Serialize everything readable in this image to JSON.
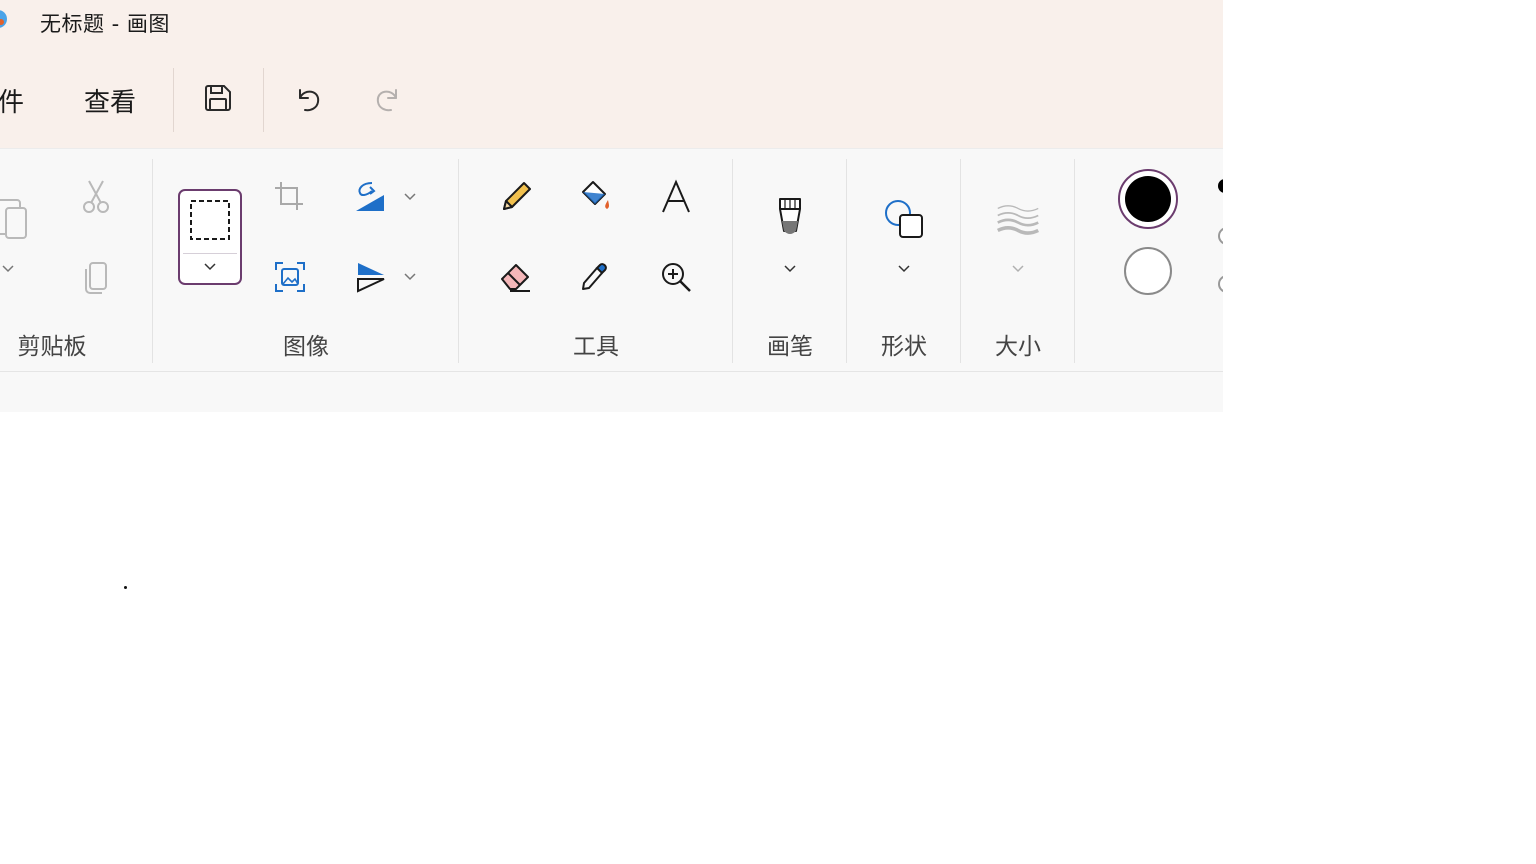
{
  "window": {
    "title": "无标题 - 画图"
  },
  "menu": {
    "file_label": "件",
    "view_label": "查看"
  },
  "quick_access": {
    "save_icon": "save-icon",
    "undo_icon": "undo-icon",
    "redo_icon": "redo-icon"
  },
  "ribbon": {
    "groups": {
      "clipboard": "剪贴板",
      "image": "图像",
      "tools": "工具",
      "brushes": "画笔",
      "shapes": "形状",
      "size": "大小"
    }
  },
  "colors": {
    "primary": "#000000",
    "secondary": "#ffffff",
    "accent_ring": "#6b3c6e",
    "titlebar_bg": "#f9f0eb",
    "ribbon_bg": "#f8f8f8",
    "blue_icon": "#1e6fc8",
    "pencil_body": "#f2c14e",
    "eraser_pink": "#f4b7b9",
    "fill_drop": "#e2612b"
  }
}
